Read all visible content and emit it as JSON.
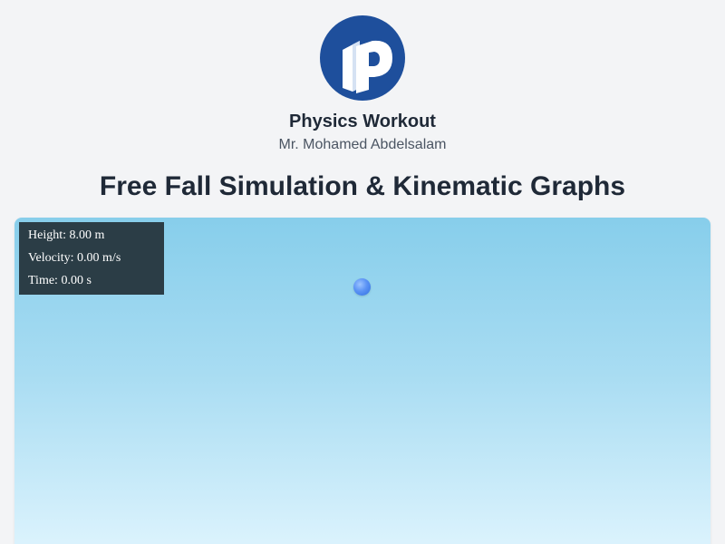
{
  "header": {
    "logo_icon": "physics-workout-logo-icon",
    "brand_title": "Physics Workout",
    "brand_subtitle": "Mr. Mohamed Abdelsalam",
    "page_title": "Free Fall Simulation & Kinematic Graphs"
  },
  "simulation": {
    "readout": {
      "height": "Height: 8.00 m",
      "velocity": "Velocity: 0.00 m/s",
      "time": "Time: 0.00 s"
    },
    "colors": {
      "sky_top": "#87ceeb",
      "sky_bottom": "#e0f5fe",
      "ball": "#5b93f5",
      "readout_bg": "#2b3d46"
    }
  },
  "colors": {
    "logo_bg": "#1e4f9c",
    "page_bg": "#f3f4f6",
    "title_text": "#1f2937"
  }
}
